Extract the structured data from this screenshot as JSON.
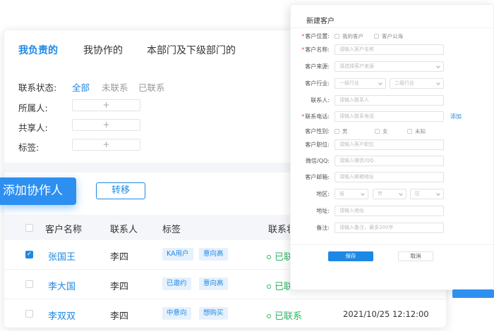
{
  "tabs": [
    "我负责的",
    "我协作的",
    "本部门及下级部门的"
  ],
  "filters": {
    "status_label": "联系状态:",
    "status_options": [
      "全部",
      "未联系",
      "已联系"
    ],
    "owner_label": "所属人:",
    "sharer_label": "共享人:",
    "tag_label": "标签:",
    "plus": "+"
  },
  "actions": {
    "add_collaborator": "添加协作人",
    "transfer": "转移"
  },
  "table": {
    "columns": [
      "客户名称",
      "联系人",
      "标签",
      "联系状"
    ],
    "rows": [
      {
        "name": "张国王",
        "contact": "李四",
        "tags": [
          "KA用户",
          "意向高"
        ],
        "status": "已联",
        "time": "",
        "checked": "✓"
      },
      {
        "name": "李大国",
        "contact": "李四",
        "tags": [
          "已邀约",
          "意向高"
        ],
        "status": "已联",
        "time": "",
        "checked": ""
      },
      {
        "name": "李双双",
        "contact": "李四",
        "tags": [
          "中意向",
          "想购买"
        ],
        "status": "已联系",
        "time": "2021/10/25 12:12:00",
        "checked": ""
      }
    ]
  },
  "dialog": {
    "title": "新建客户",
    "fields": {
      "position": {
        "label": "客户位置:",
        "opt1": "我的客户",
        "opt2": "客户公海"
      },
      "name": {
        "label": "客户名称:",
        "placeholder": "请输入客户名称"
      },
      "source": {
        "label": "客户来源:",
        "placeholder": "请选择客户来源"
      },
      "industry": {
        "label": "客户行业:",
        "placeholder1": "一级行业",
        "placeholder2": "二级行业"
      },
      "contact": {
        "label": "联系人:",
        "placeholder": "请输入联系人"
      },
      "phone": {
        "label": "联系电话:",
        "placeholder": "请输入联系电话",
        "add": "添加"
      },
      "gender": {
        "label": "客户性别:",
        "opt1": "男",
        "opt2": "女",
        "opt3": "未知"
      },
      "job": {
        "label": "客户职位:",
        "placeholder": "请输入客户职位"
      },
      "wechat": {
        "label": "微信/QQ:",
        "placeholder": "请输入微信/QQ"
      },
      "email": {
        "label": "客户邮箱:",
        "placeholder": "请输入邮箱地址"
      },
      "region": {
        "label": "地区:",
        "p1": "省",
        "p2": "市",
        "p3": "区"
      },
      "address": {
        "label": "地址:",
        "placeholder": "请输入地址"
      },
      "remark": {
        "label": "备注:",
        "placeholder": "请输入备注，最多200字"
      }
    },
    "save": "保存",
    "cancel": "取消"
  },
  "colors": {
    "accent": "#1e88e5",
    "status_green": "#2fb463",
    "required": "#e84e40"
  }
}
